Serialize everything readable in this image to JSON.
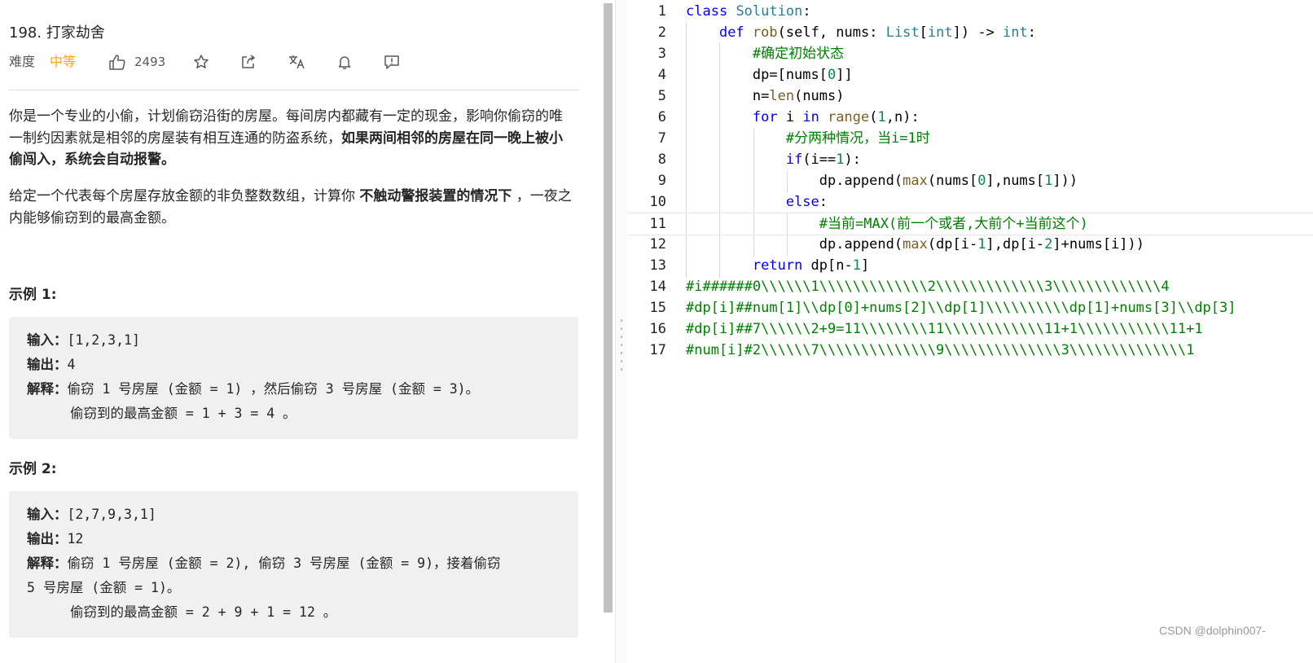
{
  "problem": {
    "title": "198. 打家劫舍",
    "difficulty_label": "难度",
    "difficulty_value": "中等",
    "like_count": "2493",
    "paragraph1_text": "你是一个专业的小偷，计划偷窃沿街的房屋。每间房内都藏有一定的现金，影响你偷窃的唯一制约因素就是相邻的房屋装有相互连通的防盗系统，",
    "paragraph1_bold": "如果两间相邻的房屋在同一晚上被小偷闯入，系统会自动报警。",
    "paragraph2_text": "给定一个代表每个房屋存放金额的非负整数数组，计算你 ",
    "paragraph2_bold": "不触动警报装置的情况下",
    "paragraph2_tail": " ，一夜之内能够偷窃到的最高金额。",
    "examples": [
      {
        "title": "示例 1:",
        "input_label": "输入：",
        "input": "[1,2,3,1]",
        "output_label": "输出：",
        "output": "4",
        "explain_label": "解释：",
        "explain_line1": "偷窃 1 号房屋 (金额 = 1) ，然后偷窃 3 号房屋 (金额 = 3)。",
        "explain_line2": "偷窃到的最高金额 = 1 + 3 = 4 。"
      },
      {
        "title": "示例 2:",
        "input_label": "输入：",
        "input": "[2,7,9,3,1]",
        "output_label": "输出：",
        "output": "12",
        "explain_label": "解释：",
        "explain_line1": "偷窃 1 号房屋 (金额 = 2), 偷窃 3 号房屋 (金额 = 9)，接着偷窃",
        "explain_line1b": "5 号房屋 (金额 = 1)。",
        "explain_line2": "偷窃到的最高金额 = 2 + 9 + 1 = 12 。"
      }
    ]
  },
  "editor": {
    "line_numbers": [
      "1",
      "2",
      "3",
      "4",
      "5",
      "6",
      "7",
      "8",
      "9",
      "10",
      "11",
      "12",
      "13",
      "14",
      "15",
      "16",
      "17"
    ],
    "comments": {
      "l3": "#确定初始状态",
      "l7": "#分两种情况，当i=1时",
      "l11": "#当前=MAX(前一个或者,大前个+当前这个)",
      "l14": "#i######0\\\\\\\\\\\\1\\\\\\\\\\\\\\\\\\\\\\\\\\2\\\\\\\\\\\\\\\\\\\\\\\\\\3\\\\\\\\\\\\\\\\\\\\\\\\\\4",
      "l15": "#dp[i]##num[1]\\\\dp[0]+nums[2]\\\\dp[1]\\\\\\\\\\\\\\\\\\\\dp[1]+nums[3]\\\\dp[3]",
      "l16": "#dp[i]##7\\\\\\\\\\\\2+9=11\\\\\\\\\\\\\\\\11\\\\\\\\\\\\\\\\\\\\\\\\11+1\\\\\\\\\\\\\\\\\\\\\\11+1",
      "l17": "#num[i]#2\\\\\\\\\\\\7\\\\\\\\\\\\\\\\\\\\\\\\\\\\9\\\\\\\\\\\\\\\\\\\\\\\\\\\\3\\\\\\\\\\\\\\\\\\\\\\\\\\\\1"
    }
  },
  "watermark": "CSDN @dolphin007-",
  "colors": {
    "difficulty_medium": "#ffa116",
    "keyword": "#0000ff",
    "class_name": "#267f99",
    "builtin": "#795e26",
    "number": "#098658",
    "comment": "#008000"
  }
}
